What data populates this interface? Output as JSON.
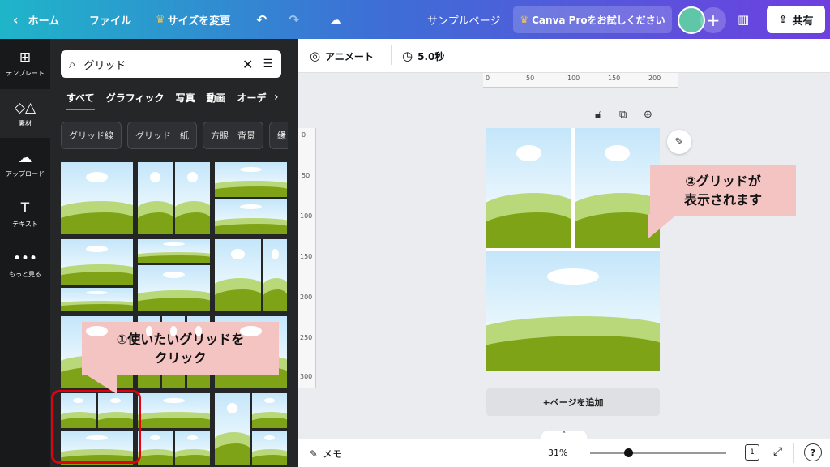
{
  "topbar": {
    "home_label": "ホーム",
    "file_label": "ファイル",
    "resize_label": "サイズを変更",
    "title": "サンプルページ",
    "pro_label": "Canva Proをお試しください",
    "share_label": "共有"
  },
  "rail": {
    "items": [
      {
        "label": "テンプレート",
        "icon": "template-icon"
      },
      {
        "label": "素材",
        "icon": "elements-icon"
      },
      {
        "label": "アップロード",
        "icon": "upload-icon"
      },
      {
        "label": "テキスト",
        "icon": "text-icon"
      },
      {
        "label": "もっと見る",
        "icon": "more-icon"
      }
    ]
  },
  "panel": {
    "search_value": "グリッド",
    "tabs": [
      "すべて",
      "グラフィック",
      "写真",
      "動画",
      "オーデ"
    ],
    "chips": [
      "グリッド線",
      "グリッド　紙",
      "方眼　背景",
      "縁"
    ]
  },
  "callouts": {
    "left": "①使いたいグリッドを\nクリック",
    "right": "②グリッドが\n表示されます"
  },
  "toolbar": {
    "animate_label": "アニメート",
    "duration_label": "5.0秒"
  },
  "rulers": {
    "top": [
      "0",
      "50",
      "100",
      "150",
      "200"
    ],
    "left": [
      "0",
      "50",
      "100",
      "150",
      "200",
      "250",
      "300"
    ]
  },
  "canvas": {
    "add_page_label": "+ページを追加"
  },
  "bottombar": {
    "notes_label": "メモ",
    "zoom_label": "31%",
    "page_count": "1",
    "help_label": "?"
  },
  "colors": {
    "accent": "#8b7df5",
    "highlight": "#e3000f",
    "callout": "#f4c4c3"
  }
}
